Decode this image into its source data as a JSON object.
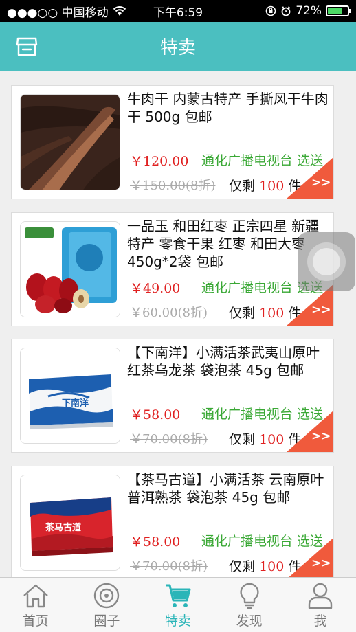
{
  "status_bar": {
    "carrier": "●●●○○ 中国移动",
    "time": "下午6:59",
    "battery_percent": "72%",
    "battery_level": 0.72
  },
  "header": {
    "title": "特卖"
  },
  "products": [
    {
      "name": "牛肉干 内蒙古特产 手撕风干牛肉干 500g 包邮",
      "price": "￥120.00",
      "seller": "通化广播电视台 选送",
      "original_price": "￥150.00(8折)",
      "stock_prefix": "仅剩",
      "stock_count": "100",
      "stock_suffix": "件",
      "image": "dried-beef"
    },
    {
      "name": "一品玉 和田红枣 正宗四星 新疆特产 零食干果 红枣 和田大枣 450g*2袋 包邮",
      "price": "￥49.00",
      "seller": "通化广播电视台 选送",
      "original_price": "￥60.00(8折)",
      "stock_prefix": "仅剩",
      "stock_count": "100",
      "stock_suffix": "件",
      "image": "red-dates"
    },
    {
      "name": "【下南洋】小满活茶武夷山原叶红茶乌龙茶 袋泡茶 45g 包邮",
      "price": "￥58.00",
      "seller": "通化广播电视台 选送",
      "original_price": "￥70.00(8折)",
      "stock_prefix": "仅剩",
      "stock_count": "100",
      "stock_suffix": "件",
      "image": "tea-box-blue",
      "box_text": "下南洋"
    },
    {
      "name": "【茶马古道】小满活茶 云南原叶普洱熟茶 袋泡茶 45g 包邮",
      "price": "￥58.00",
      "seller": "通化广播电视台 选送",
      "original_price": "￥70.00(8折)",
      "stock_prefix": "仅剩",
      "stock_count": "100",
      "stock_suffix": "件",
      "image": "tea-box-red",
      "box_text": "茶马古道"
    }
  ],
  "corner_badge": {
    "label": ">>",
    "color": "#f05a3c"
  },
  "tabs": [
    {
      "label": "首页",
      "icon": "home-icon"
    },
    {
      "label": "圈子",
      "icon": "circle-icon"
    },
    {
      "label": "特卖",
      "icon": "cart-icon",
      "active": true
    },
    {
      "label": "发现",
      "icon": "lightbulb-icon"
    },
    {
      "label": "我",
      "icon": "user-icon"
    }
  ],
  "colors": {
    "accent": "#4bbfc0",
    "active_tab": "#2bb5b8",
    "price": "#e02020",
    "seller": "#3aa835"
  }
}
